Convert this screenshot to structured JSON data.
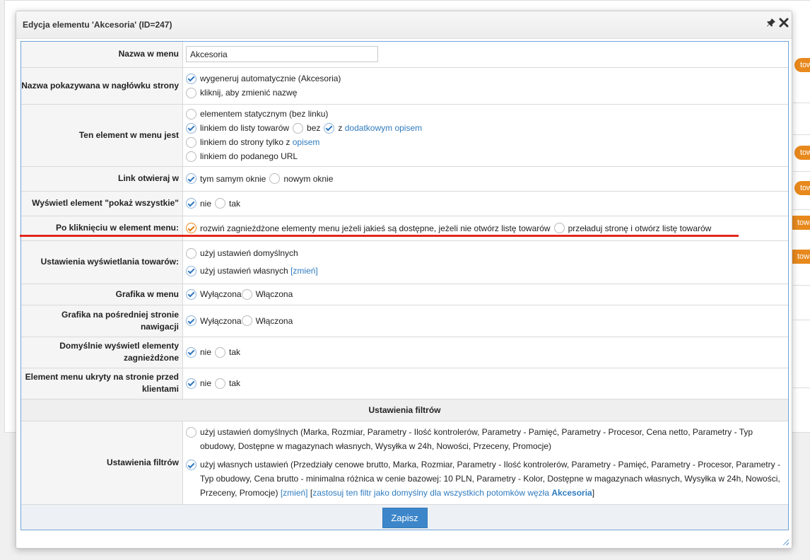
{
  "dialog": {
    "title": "Edycja elementu 'Akcesoria' (ID=247)",
    "icons": [
      "pin-icon",
      "close-icon"
    ]
  },
  "background": {
    "tags": [
      "tow",
      "tow",
      "tow",
      "towa",
      "towa"
    ]
  },
  "form": {
    "menu_name": {
      "label": "Nazwa w menu",
      "value": "Akcesoria"
    },
    "header_name": {
      "label": "Nazwa pokazywana w nagłówku strony",
      "option1": "wygeneruj automatycznie (Akcesoria)",
      "option2": "kliknij, aby zmienić nazwę"
    },
    "element_type": {
      "label": "Ten element w menu jest",
      "option1": "elementem statycznym (bez linku)",
      "option2": "linkiem do listy towarów",
      "option2_bez": "bez",
      "option2_z": "z",
      "option2_link": "dodatkowym opisem",
      "option3": "linkiem do strony tylko z",
      "option3_link": "opisem",
      "option4": "linkiem do podanego URL"
    },
    "link_open": {
      "label": "Link otwieraj w",
      "option1": "tym samym oknie",
      "option2": "nowym oknie"
    },
    "show_all": {
      "label": "Wyświetl element \"pokaż wszystkie\"",
      "option1": "nie",
      "option2": "tak"
    },
    "on_click": {
      "label": "Po kliknięciu w element menu:",
      "option1": "rozwiń zagnieżdżone elementy menu jeżeli jakieś są dostępne, jeżeli nie otwórz listę towarów",
      "option2": "przeładuj stronę i otwórz listę towarów"
    },
    "product_display": {
      "label": "Ustawienia wyświetlania towarów:",
      "option1": "użyj ustawień domyślnych",
      "option2": "użyj ustawień własnych",
      "change_link": "[zmień]"
    },
    "menu_graphic": {
      "label": "Grafika w menu",
      "option1": "Wyłączona",
      "option2": "Włączona"
    },
    "intermediate_graphic": {
      "label": "Grafika na pośredniej stronie nawigacji",
      "option1": "Wyłączona",
      "option2": "Włączona"
    },
    "show_nested": {
      "label": "Domyślnie wyświetl elementy zagnieżdżone",
      "option1": "nie",
      "option2": "tak"
    },
    "hidden": {
      "label": "Element menu ukryty na stronie przed klientami",
      "option1": "nie",
      "option2": "tak"
    },
    "filters_section": "Ustawienia filtrów",
    "filters": {
      "label": "Ustawienia filtrów",
      "option1": "użyj ustawień domyślnych (Marka, Rozmiar, Parametry - Ilość kontrolerów, Parametry - Pamięć, Parametry - Procesor, Cena netto, Parametry - Typ obudowy, Dostępne w magazynach własnych, Wysyłka w 24h, Nowości, Przeceny, Promocje)",
      "option2": "użyj własnych ustawień (Przedziały cenowe brutto, Marka, Rozmiar, Parametry - Ilość kontrolerów, Parametry - Pamięć, Parametry - Procesor, Parametry - Typ obudowy, Cena brutto - minimalna różnica w cenie bazowej: 10 PLN, Parametry - Kolor, Dostępne w magazynach własnych, Wysyłka w 24h, Nowości, Przeceny, Promocje)",
      "change_link": "[zmień]",
      "apply_link_open": "[",
      "apply_link": "zastosuj ten filtr jako domyślny dla wszystkich potomków węzła",
      "apply_node": "Akcesoria",
      "apply_link_close": "]"
    },
    "save": "Zapisz"
  },
  "colors": {
    "accent": "#3d86c9",
    "highlight": "#e2271c",
    "tag": "#e8891d"
  }
}
